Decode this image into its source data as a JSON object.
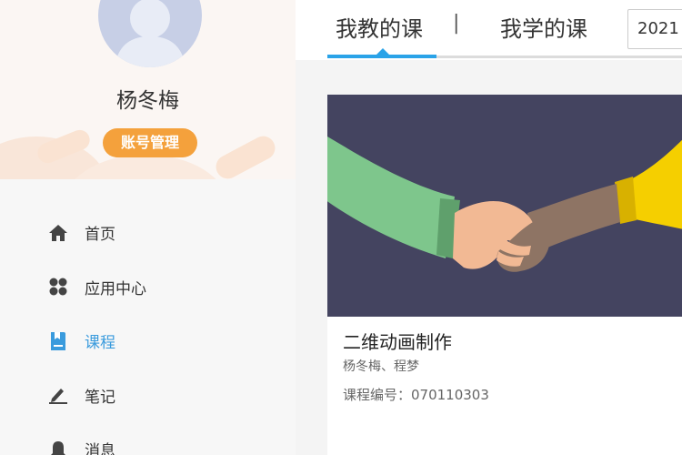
{
  "profile": {
    "name": "杨冬梅",
    "account_button": "账号管理"
  },
  "nav": {
    "items": [
      {
        "label": "首页",
        "icon": "home-icon"
      },
      {
        "label": "应用中心",
        "icon": "app-center-icon"
      },
      {
        "label": "课程",
        "icon": "course-icon",
        "active": true
      },
      {
        "label": "笔记",
        "icon": "note-icon"
      },
      {
        "label": "消息",
        "icon": "bell-icon"
      }
    ]
  },
  "tabs": {
    "teaching": "我教的课",
    "separator": "|",
    "learning": "我学的课",
    "year": "2021"
  },
  "course": {
    "title": "二维动画制作",
    "teachers": "杨冬梅、程梦",
    "code": "课程编号：070110303",
    "image": "handshake-illustration"
  },
  "colors": {
    "accent": "#2aa3e8",
    "active_nav": "#3a9bdd",
    "account_button": "#f4a13c",
    "card_image_bg": "#444460"
  }
}
